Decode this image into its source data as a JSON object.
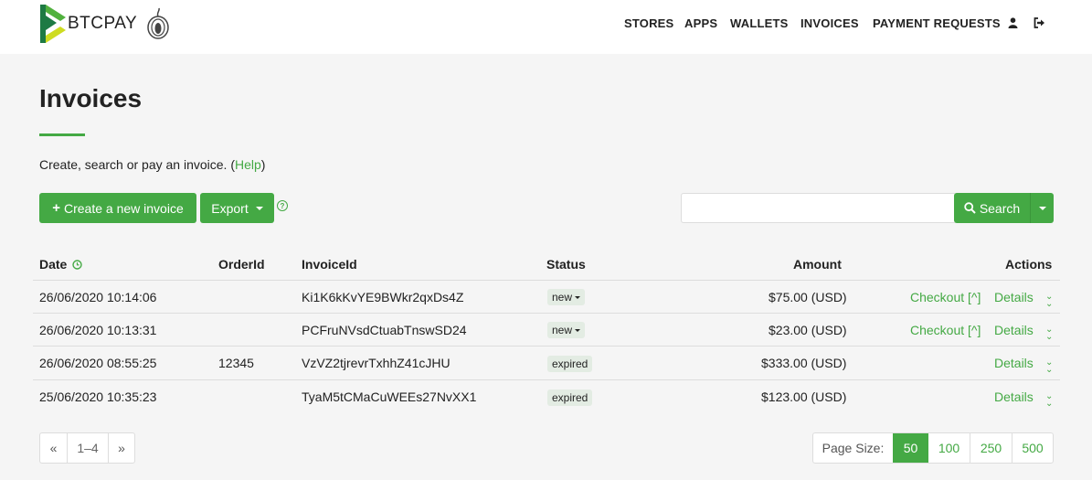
{
  "brand": {
    "name": "BTCPAY"
  },
  "nav": {
    "items": [
      "STORES",
      "APPS",
      "WALLETS",
      "INVOICES",
      "PAYMENT REQUESTS"
    ],
    "icons": [
      "user-icon",
      "sign-out-icon"
    ]
  },
  "page": {
    "title": "Invoices",
    "intro_prefix": "Create, search or pay an invoice. (",
    "intro_link": "Help",
    "intro_suffix": ")"
  },
  "toolbar": {
    "create_label": "Create a new invoice",
    "export_label": "Export",
    "help_glyph": "?",
    "search_value": "",
    "search_label": "Search"
  },
  "table": {
    "headers": {
      "date": "Date",
      "order_id": "OrderId",
      "invoice_id": "InvoiceId",
      "status": "Status",
      "amount": "Amount",
      "actions": "Actions"
    },
    "rows": [
      {
        "date": "26/06/2020 10:14:06",
        "order_id": "",
        "invoice_id": "Ki1K6kKvYE9BWkr2qxDs4Z",
        "status": "new",
        "amount": "$75.00 (USD)",
        "checkout": "Checkout [^]",
        "details": "Details"
      },
      {
        "date": "26/06/2020 10:13:31",
        "order_id": "",
        "invoice_id": "PCFruNVsdCtuabTnswSD24",
        "status": "new",
        "amount": "$23.00 (USD)",
        "checkout": "Checkout [^]",
        "details": "Details"
      },
      {
        "date": "26/06/2020 08:55:25",
        "order_id": "12345",
        "invoice_id": "VzVZ2tjrevrTxhhZ41cJHU",
        "status": "expired",
        "amount": "$333.00 (USD)",
        "checkout": "",
        "details": "Details"
      },
      {
        "date": "25/06/2020 10:35:23",
        "order_id": "",
        "invoice_id": "TyaM5tCMaCuWEEs27NvXX1",
        "status": "expired",
        "amount": "$123.00 (USD)",
        "checkout": "",
        "details": "Details"
      }
    ]
  },
  "pagination": {
    "prev": "«",
    "range": "1–4",
    "next": "»",
    "page_size_label": "Page Size:",
    "sizes": [
      "50",
      "100",
      "250",
      "500"
    ],
    "selected_size": "50"
  },
  "colors": {
    "accent": "#44a944",
    "background": "#f5f5f5"
  }
}
